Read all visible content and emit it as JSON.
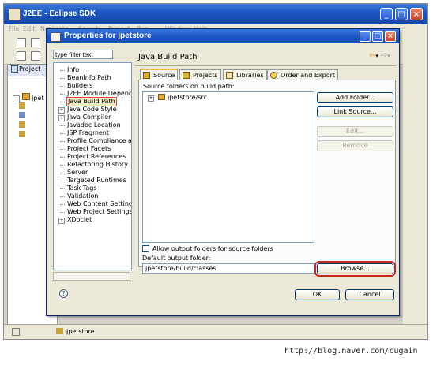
{
  "eclipse": {
    "title": "J2EE - Eclipse SDK",
    "menu": [
      "File",
      "Edit",
      "Navigate",
      "Search",
      "Project",
      "Run",
      "Window",
      "Help"
    ],
    "view_tab": "Project",
    "tree_item": "jpet",
    "right_fragment": "va",
    "status_text": "jpetstore",
    "window_controls": [
      "minimize-icon",
      "maximize-icon",
      "close-icon"
    ]
  },
  "dialog": {
    "title": "Properties for jpetstore",
    "filter_placeholder": "type filter text",
    "nav": [
      {
        "label": "Info",
        "expandable": false
      },
      {
        "label": "BeanInfo Path",
        "expandable": false
      },
      {
        "label": "Builders",
        "expandable": false
      },
      {
        "label": "J2EE Module Depenc",
        "expandable": false
      },
      {
        "label": "Java Build Path",
        "expandable": false,
        "selected": true
      },
      {
        "label": "Java Code Style",
        "expandable": true
      },
      {
        "label": "Java Compiler",
        "expandable": true
      },
      {
        "label": "Javadoc Location",
        "expandable": false
      },
      {
        "label": "JSP Fragment",
        "expandable": false
      },
      {
        "label": "Profile Compliance a",
        "expandable": false
      },
      {
        "label": "Project Facets",
        "expandable": false
      },
      {
        "label": "Project References",
        "expandable": false
      },
      {
        "label": "Refactoring History",
        "expandable": false
      },
      {
        "label": "Server",
        "expandable": false
      },
      {
        "label": "Targeted Runtimes",
        "expandable": false
      },
      {
        "label": "Task Tags",
        "expandable": false
      },
      {
        "label": "Validation",
        "expandable": false
      },
      {
        "label": "Web Content Settings",
        "expandable": false
      },
      {
        "label": "Web Project Settings",
        "expandable": false
      },
      {
        "label": "XDoclet",
        "expandable": true
      }
    ],
    "page_title": "Java Build Path",
    "tabs": [
      "Source",
      "Projects",
      "Libraries",
      "Order and Export"
    ],
    "source": {
      "folders_label": "Source folders on build path:",
      "folders": [
        "jpetstore/src"
      ],
      "buttons": {
        "add_folder": "Add Folder...",
        "link_source": "Link Source...",
        "edit": "Edit...",
        "remove": "Remove"
      },
      "allow_output_label": "Allow output folders for source folders",
      "allow_output_checked": false,
      "default_output_label": "Default output folder:",
      "default_output_value": "jpetstore/build/classes",
      "browse": "Browse..."
    },
    "ok": "OK",
    "cancel": "Cancel",
    "help": "?"
  },
  "watermark": "http://blog.naver.com/cugain"
}
